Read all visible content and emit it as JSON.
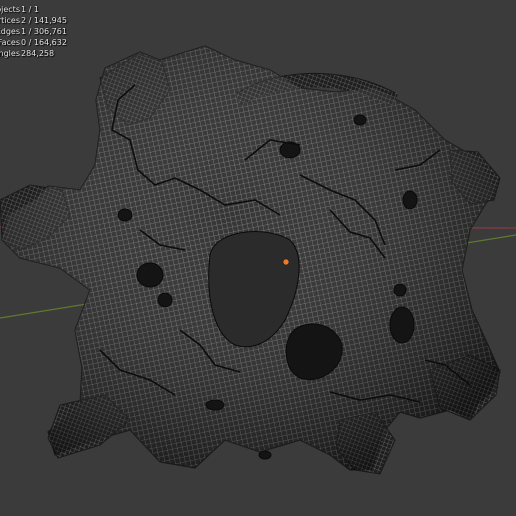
{
  "viewport": {
    "statistics": [
      {
        "label": "Objects",
        "value": "1 / 1"
      },
      {
        "label": "Vertices",
        "value": "2 / 141,945"
      },
      {
        "label": "Edges",
        "value": "1 / 306,761"
      },
      {
        "label": "Faces",
        "value": "0 / 164,632"
      },
      {
        "label": "Triangles",
        "value": "284,258"
      }
    ],
    "colors": {
      "background": "#3b3b3b",
      "mesh": "#242424",
      "wire": "#9a9a9a",
      "x_axis": "#8a3a42",
      "y_axis": "#5e7a2e",
      "origin": "#f07a26"
    }
  }
}
